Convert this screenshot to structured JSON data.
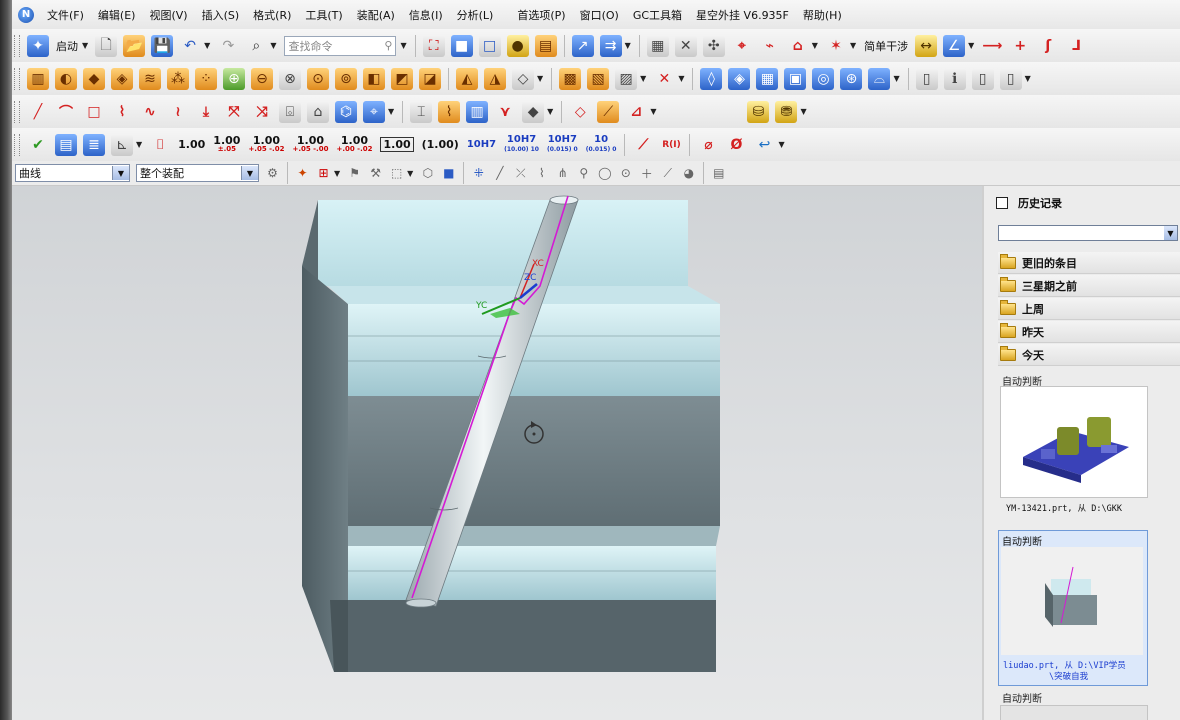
{
  "menubar": {
    "items": [
      "文件(F)",
      "编辑(E)",
      "视图(V)",
      "插入(S)",
      "格式(R)",
      "工具(T)",
      "装配(A)",
      "信息(I)",
      "分析(L)",
      "首选项(P)",
      "窗口(O)",
      "GC工具箱",
      "星空外挂 V6.935F",
      "帮助(H)"
    ]
  },
  "toolbar": {
    "start_label": "启动",
    "search_placeholder": "查找命令",
    "simple_interference_label": "简单干涉",
    "dims": [
      {
        "top": "1.00",
        "sub": ""
      },
      {
        "top": "1.00",
        "sub": "±.05"
      },
      {
        "top": "1.00",
        "sub": "+.05 -.02"
      },
      {
        "top": "1.00",
        "sub": "+.05 -.00"
      },
      {
        "top": "1.00",
        "sub": "+.00 -.02"
      }
    ],
    "boxed_dim": "1.00",
    "paren_dim": "(1.00)",
    "fit1": "10H7",
    "fit2": "10H7",
    "fit2_sub": "(10.00) 10",
    "fit3": "10H7",
    "fit3_sub": "(0.015) 0",
    "fit4": "10",
    "fit4_sub": "(0.015) 0",
    "r_label": "R(I)"
  },
  "selection": {
    "filter_value": "曲线",
    "scope_value": "整个装配"
  },
  "viewport": {
    "axis_xc": "XC",
    "axis_yc": "YC",
    "axis_zc": "ZC"
  },
  "history": {
    "title": "历史记录",
    "filter_value": "",
    "folders": [
      "更旧的条目",
      "三星期之前",
      "上周",
      "昨天",
      "今天"
    ],
    "cards": [
      {
        "label": "自动判断",
        "caption": "YM-13421.prt, 从 D:\\GKK"
      },
      {
        "label": "自动判断",
        "caption_line1": "liudao.prt, 从 D:\\VIP学员",
        "caption_line2": "\\突破自我"
      },
      {
        "label": "自动判断"
      }
    ]
  }
}
